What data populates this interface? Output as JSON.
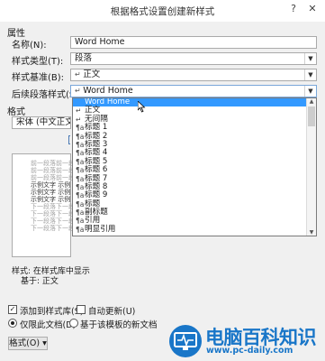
{
  "window": {
    "title": "根据格式设置创建新样式",
    "help": "?",
    "close": "✕"
  },
  "properties": {
    "group_label": "属性",
    "name_label": "名称(N):",
    "name_value": "Word Home",
    "style_type_label": "样式类型(T):",
    "style_type_value": "段落",
    "based_on_label": "样式基准(B):",
    "based_on_value": "正文",
    "next_para_label": "后续段落样式(S):",
    "next_para_value": "Word Home"
  },
  "dropdown": {
    "items": [
      {
        "label": "Word Home",
        "icon": "paragraph-icon",
        "selected": true
      },
      {
        "label": "正文",
        "icon": "paragraph-icon"
      },
      {
        "label": "无间隔",
        "icon": "paragraph-icon"
      },
      {
        "label": "标题 1",
        "icon": "linked-style-icon"
      },
      {
        "label": "标题 2",
        "icon": "linked-style-icon"
      },
      {
        "label": "标题 3",
        "icon": "linked-style-icon"
      },
      {
        "label": "标题 4",
        "icon": "linked-style-icon"
      },
      {
        "label": "标题 5",
        "icon": "linked-style-icon"
      },
      {
        "label": "标题 6",
        "icon": "linked-style-icon"
      },
      {
        "label": "标题 7",
        "icon": "linked-style-icon"
      },
      {
        "label": "标题 8",
        "icon": "linked-style-icon"
      },
      {
        "label": "标题 9",
        "icon": "linked-style-icon"
      },
      {
        "label": "标题",
        "icon": "linked-style-icon"
      },
      {
        "label": "副标题",
        "icon": "linked-style-icon"
      },
      {
        "label": "引用",
        "icon": "linked-style-icon"
      },
      {
        "label": "明显引用",
        "icon": "linked-style-icon"
      }
    ]
  },
  "format": {
    "group_label": "格式",
    "font_value": "宋体 (中文正文)"
  },
  "preview": {
    "prev_text": "前一段落前一段落前一段落",
    "sample_text": "示例文字 示例",
    "next_text": "下一段落下一段落下一段落"
  },
  "description": {
    "line1": "样式: 在样式库中显示",
    "line2": "基于: 正文"
  },
  "options": {
    "add_to_gallery": "添加到样式库(S)",
    "auto_update": "自动更新(U)",
    "only_this_doc": "仅限此文档(D)",
    "new_docs_template": "基于该模板的新文档"
  },
  "buttons": {
    "format": "格式(O) ▾"
  },
  "watermark": {
    "text": "电脑百科知识",
    "url": "www.pc-daily.com"
  },
  "colors": {
    "selection": "#3399ff",
    "watermark": "#1976c8"
  }
}
